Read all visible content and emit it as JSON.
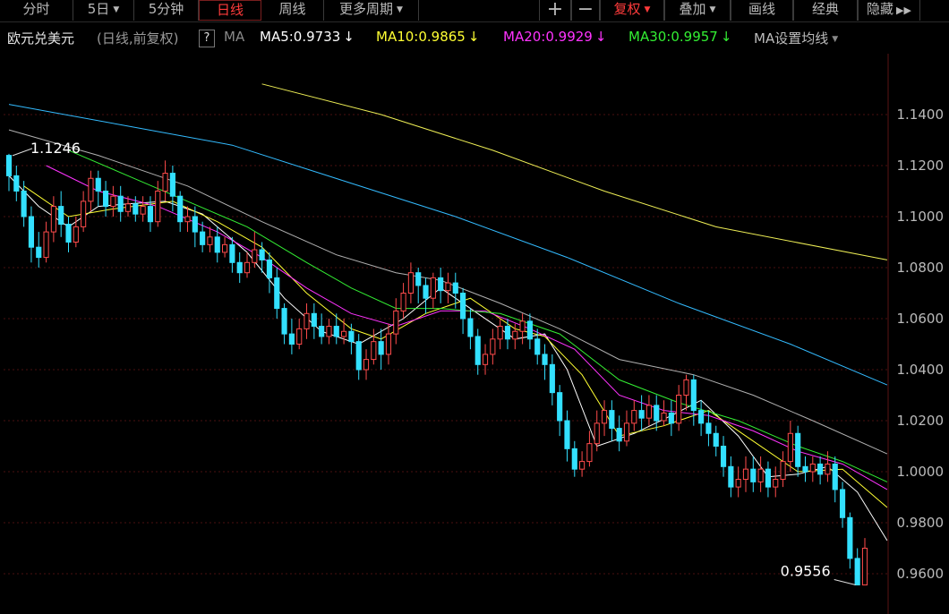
{
  "toolbar": {
    "tabs": [
      {
        "label": "分时",
        "caret": false,
        "active": false
      },
      {
        "label": "5日",
        "caret": true,
        "active": false
      },
      {
        "label": "5分钟",
        "caret": false,
        "active": false
      },
      {
        "label": "日线",
        "caret": false,
        "active": true
      },
      {
        "label": "周线",
        "caret": false,
        "active": false
      },
      {
        "label": "更多周期",
        "caret": true,
        "active": false
      }
    ],
    "right": [
      {
        "label": "+",
        "caret": false,
        "red": false
      },
      {
        "label": "−",
        "caret": false,
        "red": false
      },
      {
        "label": "复权",
        "caret": true,
        "red": true
      },
      {
        "label": "叠加",
        "caret": true,
        "red": false
      },
      {
        "label": "画线",
        "caret": false,
        "red": false
      },
      {
        "label": "经典",
        "caret": false,
        "red": false
      },
      {
        "label": "隐藏",
        "caret": false,
        "red": false
      }
    ],
    "more_icon": "double-chevron-right-icon",
    "caret_glyph": "▼"
  },
  "legend": {
    "title": "欧元兑美元",
    "subtitle": "(日线,前复权)",
    "help": "?",
    "ma_label": "MA",
    "items": [
      {
        "text": "MA5:0.9733",
        "color": "#ffffff",
        "arrow": "↓"
      },
      {
        "text": "MA10:0.9865",
        "color": "#ffff33",
        "arrow": "↓"
      },
      {
        "text": "MA20:0.9929",
        "color": "#ff33ff",
        "arrow": "↓"
      },
      {
        "text": "MA30:0.9957",
        "color": "#33ee33",
        "arrow": "↓"
      }
    ],
    "settings": "MA设置均线",
    "settings_caret": "▼"
  },
  "chart_data": {
    "type": "candlestick",
    "yticks": [
      "1.1400",
      "1.1200",
      "1.1000",
      "1.0800",
      "1.0600",
      "1.0400",
      "1.0200",
      "1.0000",
      "0.9800",
      "0.9600"
    ],
    "ylim": [
      0.955,
      1.16
    ],
    "grid": true,
    "high_label": "1.1246",
    "low_label": "0.9556",
    "colors": {
      "up": "#ff4b4b",
      "down": "#33e0ff",
      "grid": "#4a1010",
      "axis_text": "#bbbbbb"
    },
    "candles": [
      [
        1.124,
        1.116,
        1.1246,
        1.11
      ],
      [
        1.116,
        1.11,
        1.12,
        1.106
      ],
      [
        1.11,
        1.1,
        1.114,
        1.096
      ],
      [
        1.1,
        1.088,
        1.104,
        1.082
      ],
      [
        1.088,
        1.084,
        1.094,
        1.08
      ],
      [
        1.084,
        1.094,
        1.098,
        1.082
      ],
      [
        1.094,
        1.104,
        1.108,
        1.09
      ],
      [
        1.104,
        1.097,
        1.11,
        1.092
      ],
      [
        1.097,
        1.09,
        1.1,
        1.086
      ],
      [
        1.09,
        1.096,
        1.1,
        1.088
      ],
      [
        1.096,
        1.106,
        1.11,
        1.094
      ],
      [
        1.106,
        1.115,
        1.118,
        1.102
      ],
      [
        1.115,
        1.11,
        1.118,
        1.104
      ],
      [
        1.11,
        1.104,
        1.114,
        1.1
      ],
      [
        1.104,
        1.108,
        1.112,
        1.1
      ],
      [
        1.108,
        1.102,
        1.112,
        1.098
      ],
      [
        1.102,
        1.105,
        1.108,
        1.1
      ],
      [
        1.105,
        1.101,
        1.108,
        1.098
      ],
      [
        1.101,
        1.104,
        1.108,
        1.098
      ],
      [
        1.104,
        1.098,
        1.108,
        1.094
      ],
      [
        1.098,
        1.11,
        1.114,
        1.096
      ],
      [
        1.11,
        1.117,
        1.122,
        1.106
      ],
      [
        1.117,
        1.108,
        1.12,
        1.102
      ],
      [
        1.108,
        1.098,
        1.11,
        1.094
      ],
      [
        1.098,
        1.1,
        1.104,
        1.094
      ],
      [
        1.1,
        1.094,
        1.104,
        1.088
      ],
      [
        1.094,
        1.089,
        1.098,
        1.086
      ],
      [
        1.089,
        1.092,
        1.096,
        1.086
      ],
      [
        1.092,
        1.086,
        1.096,
        1.082
      ],
      [
        1.086,
        1.089,
        1.092,
        1.084
      ],
      [
        1.089,
        1.082,
        1.092,
        1.078
      ],
      [
        1.082,
        1.078,
        1.086,
        1.074
      ],
      [
        1.078,
        1.082,
        1.086,
        1.076
      ],
      [
        1.082,
        1.087,
        1.094,
        1.08
      ],
      [
        1.087,
        1.083,
        1.09,
        1.078
      ],
      [
        1.083,
        1.076,
        1.086,
        1.07
      ],
      [
        1.076,
        1.064,
        1.08,
        1.06
      ],
      [
        1.064,
        1.054,
        1.066,
        1.05
      ],
      [
        1.054,
        1.05,
        1.06,
        1.046
      ],
      [
        1.05,
        1.056,
        1.06,
        1.048
      ],
      [
        1.056,
        1.062,
        1.066,
        1.052
      ],
      [
        1.062,
        1.057,
        1.066,
        1.052
      ],
      [
        1.057,
        1.053,
        1.062,
        1.05
      ],
      [
        1.053,
        1.057,
        1.06,
        1.05
      ],
      [
        1.057,
        1.053,
        1.062,
        1.05
      ],
      [
        1.053,
        1.055,
        1.06,
        1.05
      ],
      [
        1.055,
        1.051,
        1.058,
        1.046
      ],
      [
        1.051,
        1.04,
        1.054,
        1.036
      ],
      [
        1.04,
        1.044,
        1.048,
        1.036
      ],
      [
        1.044,
        1.051,
        1.056,
        1.042
      ],
      [
        1.051,
        1.046,
        1.056,
        1.04
      ],
      [
        1.046,
        1.054,
        1.058,
        1.042
      ],
      [
        1.054,
        1.063,
        1.068,
        1.05
      ],
      [
        1.063,
        1.07,
        1.074,
        1.06
      ],
      [
        1.07,
        1.078,
        1.082,
        1.066
      ],
      [
        1.078,
        1.073,
        1.08,
        1.066
      ],
      [
        1.073,
        1.068,
        1.076,
        1.062
      ],
      [
        1.068,
        1.076,
        1.078,
        1.064
      ],
      [
        1.076,
        1.071,
        1.08,
        1.066
      ],
      [
        1.071,
        1.074,
        1.078,
        1.066
      ],
      [
        1.074,
        1.07,
        1.078,
        1.064
      ],
      [
        1.07,
        1.06,
        1.072,
        1.054
      ],
      [
        1.06,
        1.053,
        1.064,
        1.048
      ],
      [
        1.053,
        1.042,
        1.056,
        1.038
      ],
      [
        1.042,
        1.046,
        1.05,
        1.038
      ],
      [
        1.046,
        1.052,
        1.056,
        1.042
      ],
      [
        1.052,
        1.057,
        1.06,
        1.048
      ],
      [
        1.057,
        1.052,
        1.06,
        1.048
      ],
      [
        1.052,
        1.055,
        1.058,
        1.048
      ],
      [
        1.055,
        1.059,
        1.062,
        1.05
      ],
      [
        1.059,
        1.052,
        1.062,
        1.048
      ],
      [
        1.052,
        1.046,
        1.056,
        1.042
      ],
      [
        1.046,
        1.042,
        1.05,
        1.036
      ],
      [
        1.042,
        1.031,
        1.046,
        1.026
      ],
      [
        1.031,
        1.02,
        1.034,
        1.014
      ],
      [
        1.02,
        1.009,
        1.024,
        1.004
      ],
      [
        1.009,
        1.001,
        1.012,
        0.998
      ],
      [
        1.001,
        1.004,
        1.008,
        0.998
      ],
      [
        1.004,
        1.011,
        1.016,
        1.002
      ],
      [
        1.011,
        1.019,
        1.024,
        1.008
      ],
      [
        1.019,
        1.024,
        1.028,
        1.014
      ],
      [
        1.024,
        1.017,
        1.028,
        1.012
      ],
      [
        1.017,
        1.012,
        1.022,
        1.008
      ],
      [
        1.012,
        1.019,
        1.024,
        1.01
      ],
      [
        1.019,
        1.024,
        1.028,
        1.016
      ],
      [
        1.024,
        1.021,
        1.03,
        1.016
      ],
      [
        1.021,
        1.026,
        1.03,
        1.018
      ],
      [
        1.026,
        1.02,
        1.03,
        1.016
      ],
      [
        1.02,
        1.023,
        1.028,
        1.018
      ],
      [
        1.023,
        1.019,
        1.028,
        1.014
      ],
      [
        1.019,
        1.03,
        1.034,
        1.016
      ],
      [
        1.03,
        1.036,
        1.038,
        1.024
      ],
      [
        1.036,
        1.024,
        1.038,
        1.018
      ],
      [
        1.024,
        1.019,
        1.028,
        1.014
      ],
      [
        1.019,
        1.015,
        1.024,
        1.01
      ],
      [
        1.015,
        1.01,
        1.018,
        1.006
      ],
      [
        1.01,
        1.002,
        1.014,
        0.998
      ],
      [
        1.002,
        0.994,
        1.006,
        0.99
      ],
      [
        0.994,
        0.997,
        1.002,
        0.99
      ],
      [
        0.997,
        1.001,
        1.006,
        0.992
      ],
      [
        1.001,
        0.996,
        1.006,
        0.992
      ],
      [
        0.996,
        1.001,
        1.006,
        0.992
      ],
      [
        1.001,
        0.994,
        1.004,
        0.99
      ],
      [
        0.994,
        0.997,
        1.002,
        0.99
      ],
      [
        0.997,
        1.004,
        1.008,
        0.994
      ],
      [
        1.004,
        1.015,
        1.02,
        1.0
      ],
      [
        1.015,
        1.002,
        1.018,
        0.998
      ],
      [
        1.002,
        1.0,
        1.006,
        0.996
      ],
      [
        1.0,
        1.003,
        1.006,
        0.996
      ],
      [
        1.003,
        0.999,
        1.006,
        0.995
      ],
      [
        0.999,
        1.003,
        1.008,
        0.996
      ],
      [
        1.003,
        0.993,
        1.006,
        0.988
      ],
      [
        0.993,
        0.982,
        0.996,
        0.978
      ],
      [
        0.982,
        0.966,
        0.984,
        0.962
      ],
      [
        0.966,
        0.9556,
        0.97,
        0.9556
      ],
      [
        0.9556,
        0.97,
        0.974,
        0.9556
      ]
    ],
    "ma_lines": [
      {
        "name": "MA5",
        "color": "#ffffff",
        "points": [
          [
            1.116,
            0
          ],
          [
            1.104,
            4
          ],
          [
            1.096,
            8
          ],
          [
            1.104,
            12
          ],
          [
            1.105,
            16
          ],
          [
            1.106,
            21
          ],
          [
            1.101,
            26
          ],
          [
            1.086,
            32
          ],
          [
            1.068,
            37
          ],
          [
            1.055,
            42
          ],
          [
            1.05,
            47
          ],
          [
            1.06,
            53
          ],
          [
            1.072,
            58
          ],
          [
            1.062,
            63
          ],
          [
            1.052,
            68
          ],
          [
            1.054,
            72
          ],
          [
            1.04,
            75
          ],
          [
            1.01,
            79
          ],
          [
            1.015,
            84
          ],
          [
            1.022,
            89
          ],
          [
            1.028,
            93
          ],
          [
            1.014,
            98
          ],
          [
            0.998,
            102
          ],
          [
            0.999,
            106
          ],
          [
            1.002,
            110
          ],
          [
            0.992,
            114
          ],
          [
            0.973,
            118
          ]
        ]
      },
      {
        "name": "MA10",
        "color": "#ffff33",
        "points": [
          [
            1.112,
            2
          ],
          [
            1.1,
            8
          ],
          [
            1.103,
            14
          ],
          [
            1.106,
            22
          ],
          [
            1.098,
            28
          ],
          [
            1.088,
            34
          ],
          [
            1.07,
            40
          ],
          [
            1.056,
            46
          ],
          [
            1.052,
            50
          ],
          [
            1.062,
            56
          ],
          [
            1.068,
            62
          ],
          [
            1.056,
            68
          ],
          [
            1.053,
            72
          ],
          [
            1.038,
            77
          ],
          [
            1.014,
            82
          ],
          [
            1.018,
            88
          ],
          [
            1.024,
            94
          ],
          [
            1.012,
            100
          ],
          [
            1.0,
            106
          ],
          [
            1.001,
            112
          ],
          [
            0.986,
            118
          ]
        ]
      },
      {
        "name": "MA20",
        "color": "#ff33ff",
        "points": [
          [
            1.12,
            5
          ],
          [
            1.11,
            12
          ],
          [
            1.104,
            20
          ],
          [
            1.094,
            28
          ],
          [
            1.084,
            34
          ],
          [
            1.072,
            40
          ],
          [
            1.062,
            46
          ],
          [
            1.057,
            52
          ],
          [
            1.063,
            58
          ],
          [
            1.063,
            64
          ],
          [
            1.056,
            70
          ],
          [
            1.048,
            76
          ],
          [
            1.03,
            82
          ],
          [
            1.024,
            88
          ],
          [
            1.022,
            94
          ],
          [
            1.016,
            100
          ],
          [
            1.008,
            106
          ],
          [
            1.003,
            112
          ],
          [
            0.993,
            118
          ]
        ]
      },
      {
        "name": "MA30",
        "color": "#33ee33",
        "points": [
          [
            1.126,
            8
          ],
          [
            1.116,
            16
          ],
          [
            1.106,
            24
          ],
          [
            1.096,
            32
          ],
          [
            1.082,
            40
          ],
          [
            1.072,
            46
          ],
          [
            1.064,
            52
          ],
          [
            1.064,
            58
          ],
          [
            1.062,
            66
          ],
          [
            1.054,
            74
          ],
          [
            1.036,
            82
          ],
          [
            1.027,
            90
          ],
          [
            1.02,
            98
          ],
          [
            1.01,
            106
          ],
          [
            1.004,
            112
          ],
          [
            0.996,
            118
          ]
        ]
      },
      {
        "name": "MA60",
        "color": "#b0b0b0",
        "points": [
          [
            1.134,
            0
          ],
          [
            1.124,
            12
          ],
          [
            1.112,
            24
          ],
          [
            1.098,
            34
          ],
          [
            1.085,
            44
          ],
          [
            1.078,
            52
          ],
          [
            1.075,
            58
          ],
          [
            1.066,
            66
          ],
          [
            1.056,
            74
          ],
          [
            1.044,
            82
          ],
          [
            1.038,
            92
          ],
          [
            1.03,
            100
          ],
          [
            1.02,
            108
          ],
          [
            1.007,
            118
          ]
        ]
      },
      {
        "name": "MA120",
        "color": "#33bbff",
        "points": [
          [
            1.144,
            0
          ],
          [
            1.136,
            15
          ],
          [
            1.128,
            30
          ],
          [
            1.114,
            45
          ],
          [
            1.1,
            60
          ],
          [
            1.084,
            75
          ],
          [
            1.066,
            90
          ],
          [
            1.05,
            105
          ],
          [
            1.034,
            118
          ]
        ]
      },
      {
        "name": "MA250",
        "color": "#eeee55",
        "points": [
          [
            1.152,
            34
          ],
          [
            1.14,
            50
          ],
          [
            1.126,
            65
          ],
          [
            1.11,
            80
          ],
          [
            1.096,
            95
          ],
          [
            1.083,
            118
          ]
        ]
      }
    ]
  }
}
